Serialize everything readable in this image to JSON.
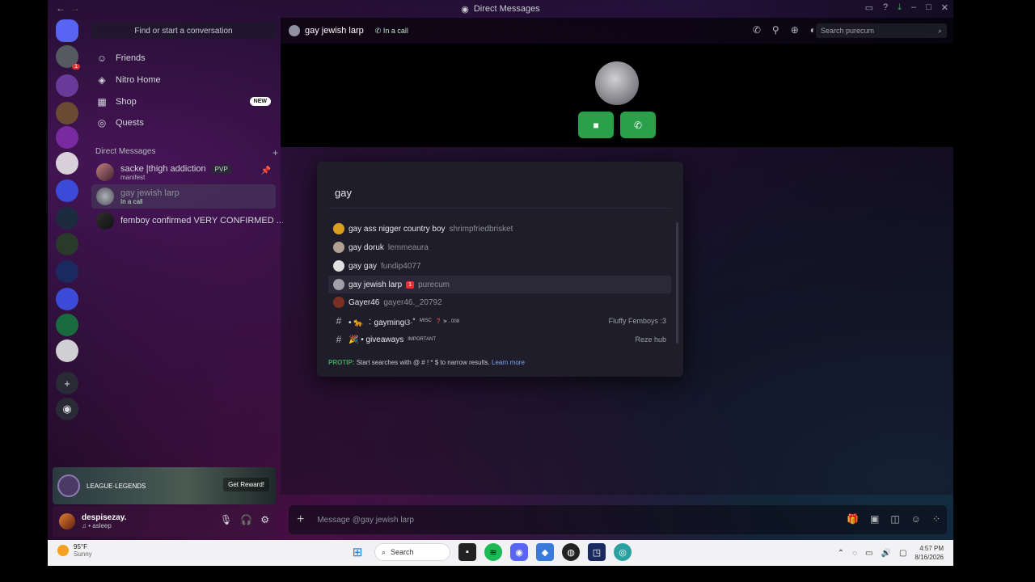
{
  "window": {
    "title": "Direct Messages"
  },
  "guilds": [
    {
      "name": "home",
      "color": "#5865f2",
      "icon": "discord-icon"
    },
    {
      "name": "server-1",
      "color": "#555a60",
      "badge": "1"
    },
    {
      "name": "server-2",
      "color": "#6a3a9a"
    },
    {
      "name": "server-3",
      "color": "#6a4a30"
    },
    {
      "name": "server-4",
      "color": "#7a2aa0"
    },
    {
      "name": "server-5",
      "color": "#d8d0d8"
    },
    {
      "name": "folder-1",
      "color": "#3b4bd8"
    },
    {
      "name": "server-6",
      "color": "#1e2a40"
    },
    {
      "name": "server-7",
      "color": "#2a3a2a"
    },
    {
      "name": "server-8",
      "color": "#1a2a60"
    },
    {
      "name": "folder-2",
      "color": "#3b4bd8"
    },
    {
      "name": "server-9",
      "color": "#1a6a40"
    },
    {
      "name": "server-10",
      "color": "#cfcfd4"
    }
  ],
  "sidebar": {
    "search_placeholder": "Find or start a conversation",
    "nav": [
      {
        "label": "Friends",
        "icon": "friends-icon"
      },
      {
        "label": "Nitro Home",
        "icon": "nitro-icon"
      },
      {
        "label": "Shop",
        "icon": "shop-icon",
        "badge": "NEW"
      },
      {
        "label": "Quests",
        "icon": "quests-icon"
      }
    ],
    "dm_header": "Direct Messages",
    "dms": [
      {
        "name": "sacke |thigh addiction",
        "tag": "PVP",
        "sub": "manifest"
      },
      {
        "name": "gay jewish larp",
        "sub": "In a call"
      },
      {
        "name": "femboy confirmed VERY CONFIRMED ..."
      }
    ]
  },
  "promo": {
    "game": "LEAGUE·LEGENDS",
    "button": "Get Reward!"
  },
  "user": {
    "name": "despisezay.",
    "status": "♫ • asleep"
  },
  "topbar": {
    "name": "gay jewish larp",
    "status": "In a call",
    "search_placeholder": "Search purecum"
  },
  "composer": {
    "placeholder": "Message @gay jewish larp"
  },
  "quickswitcher": {
    "query": "gay",
    "results": [
      {
        "name": "gay ass nigger country boy",
        "user": "shrimpfriedbrisket",
        "color": "#d8a020"
      },
      {
        "name": "gay doruk",
        "user": "lemmeaura",
        "color": "#b0a090"
      },
      {
        "name": "gay gay",
        "user": "fundip4077",
        "color": "#e0e0e0"
      },
      {
        "name": "gay jewish larp",
        "badge": "1",
        "user": "purecum",
        "color": "#a0a0a8"
      },
      {
        "name": "Gayer46",
        "user": "gayer46._20792",
        "color": "#7a3020"
      },
      {
        "name": "• 🐆 ︰gaymingଓ·˚",
        "tag": "MISC",
        "extra": "❓ ⋟ . 008",
        "server": "Fluffy Femboys :3"
      },
      {
        "name": "🎉 • giveaways",
        "tag": "IMPORTANT",
        "server": "Reze hub"
      }
    ],
    "protip_label": "PROTIP:",
    "protip_text": "Start searches with @ # ! * $ to narrow results.",
    "learn_more": "Learn more"
  },
  "taskbar": {
    "temp": "95°F",
    "condition": "Sunny",
    "search": "Search",
    "time": "4:57 PM",
    "date": "8/16/2026"
  }
}
